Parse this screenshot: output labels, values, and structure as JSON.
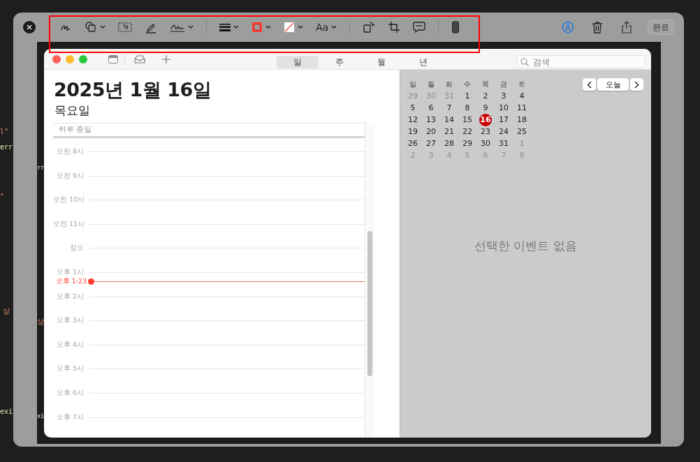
{
  "background_fragments": [
    {
      "text": "l\""
    },
    {
      "text": "err"
    },
    {
      "text": "\""
    },
    {
      "text": "상"
    },
    {
      "text": "exi"
    }
  ],
  "image_fragments": [
    {
      "text": "rr"
    },
    {
      "text": "상"
    },
    {
      "text": "xi"
    }
  ],
  "markup_toolbar": {
    "tools": [
      {
        "kind": "sketch",
        "menu": false
      },
      {
        "kind": "shapes",
        "menu": true
      },
      {
        "kind": "textbox",
        "menu": false
      },
      {
        "kind": "highlight",
        "menu": false
      },
      {
        "kind": "sign",
        "menu": true
      },
      {
        "kind": "divider"
      },
      {
        "kind": "lines",
        "menu": true
      },
      {
        "kind": "border-color",
        "menu": true
      },
      {
        "kind": "fill-color",
        "menu": true
      },
      {
        "kind": "text-style",
        "label": "Aa",
        "menu": true
      },
      {
        "kind": "divider"
      },
      {
        "kind": "rotate",
        "menu": false
      },
      {
        "kind": "crop",
        "menu": false
      },
      {
        "kind": "note",
        "menu": false
      },
      {
        "kind": "divider"
      },
      {
        "kind": "device",
        "menu": false
      }
    ],
    "actions": [
      {
        "kind": "markup",
        "on": true
      },
      {
        "kind": "trash"
      },
      {
        "kind": "share"
      }
    ],
    "done_button": "완료"
  },
  "calendar": {
    "view_tabs": [
      {
        "label": "일",
        "selected": true
      },
      {
        "label": "주",
        "selected": false
      },
      {
        "label": "월",
        "selected": false
      },
      {
        "label": "년",
        "selected": false
      }
    ],
    "search": {
      "placeholder": "검색"
    },
    "date_title": "2025년 1월 16일",
    "weekday": "목요일",
    "all_day_label": "하루 종일",
    "hours": [
      {
        "kind": "hour",
        "label": "오전 8시"
      },
      {
        "kind": "hour",
        "label": "오전 9시"
      },
      {
        "kind": "hour",
        "label": "오전 10시"
      },
      {
        "kind": "hour",
        "label": "오전 11시"
      },
      {
        "kind": "hour",
        "label": "정오"
      },
      {
        "kind": "hour",
        "label": "오후 1시"
      },
      {
        "kind": "now",
        "label": "오후 1:23"
      },
      {
        "kind": "hour",
        "label": "오후 2시"
      },
      {
        "kind": "hour",
        "label": "오후 3시"
      },
      {
        "kind": "hour",
        "label": "오후 4시"
      },
      {
        "kind": "hour",
        "label": "오후 5시"
      },
      {
        "kind": "hour",
        "label": "오후 6시"
      },
      {
        "kind": "hour",
        "label": "오후 7시"
      }
    ],
    "mini_calendar": {
      "weekdays": [
        "일",
        "월",
        "화",
        "수",
        "목",
        "금",
        "토"
      ],
      "weeks": [
        [
          {
            "day": "29",
            "muted": true,
            "selected": false
          },
          {
            "day": "30",
            "muted": true,
            "selected": false
          },
          {
            "day": "31",
            "muted": true,
            "selected": false
          },
          {
            "day": "1",
            "muted": false,
            "selected": false
          },
          {
            "day": "2",
            "muted": false,
            "selected": false
          },
          {
            "day": "3",
            "muted": false,
            "selected": false
          },
          {
            "day": "4",
            "muted": false,
            "selected": false
          }
        ],
        [
          {
            "day": "5",
            "muted": false,
            "selected": false
          },
          {
            "day": "6",
            "muted": false,
            "selected": false
          },
          {
            "day": "7",
            "muted": false,
            "selected": false
          },
          {
            "day": "8",
            "muted": false,
            "selected": false
          },
          {
            "day": "9",
            "muted": false,
            "selected": false
          },
          {
            "day": "10",
            "muted": false,
            "selected": false
          },
          {
            "day": "11",
            "muted": false,
            "selected": false
          }
        ],
        [
          {
            "day": "12",
            "muted": false,
            "selected": false
          },
          {
            "day": "13",
            "muted": false,
            "selected": false
          },
          {
            "day": "14",
            "muted": false,
            "selected": false
          },
          {
            "day": "15",
            "muted": false,
            "selected": false
          },
          {
            "day": "16",
            "muted": false,
            "selected": true
          },
          {
            "day": "17",
            "muted": false,
            "selected": false
          },
          {
            "day": "18",
            "muted": false,
            "selected": false
          }
        ],
        [
          {
            "day": "19",
            "muted": false,
            "selected": false
          },
          {
            "day": "20",
            "muted": false,
            "selected": false
          },
          {
            "day": "21",
            "muted": false,
            "selected": false
          },
          {
            "day": "22",
            "muted": false,
            "selected": false
          },
          {
            "day": "23",
            "muted": false,
            "selected": false
          },
          {
            "day": "24",
            "muted": false,
            "selected": false
          },
          {
            "day": "25",
            "muted": false,
            "selected": false
          }
        ],
        [
          {
            "day": "26",
            "muted": false,
            "selected": false
          },
          {
            "day": "27",
            "muted": false,
            "selected": false
          },
          {
            "day": "28",
            "muted": false,
            "selected": false
          },
          {
            "day": "29",
            "muted": false,
            "selected": false
          },
          {
            "day": "30",
            "muted": false,
            "selected": false
          },
          {
            "day": "31",
            "muted": false,
            "selected": false
          },
          {
            "day": "1",
            "muted": true,
            "selected": false
          }
        ],
        [
          {
            "day": "2",
            "muted": true,
            "selected": false
          },
          {
            "day": "3",
            "muted": true,
            "selected": false
          },
          {
            "day": "4",
            "muted": true,
            "selected": false
          },
          {
            "day": "5",
            "muted": true,
            "selected": false
          },
          {
            "day": "6",
            "muted": true,
            "selected": false
          },
          {
            "day": "7",
            "muted": true,
            "selected": false
          },
          {
            "day": "8",
            "muted": true,
            "selected": false
          }
        ]
      ]
    },
    "today_button": "오늘",
    "empty_message": "선택한 이벤트 없음"
  }
}
